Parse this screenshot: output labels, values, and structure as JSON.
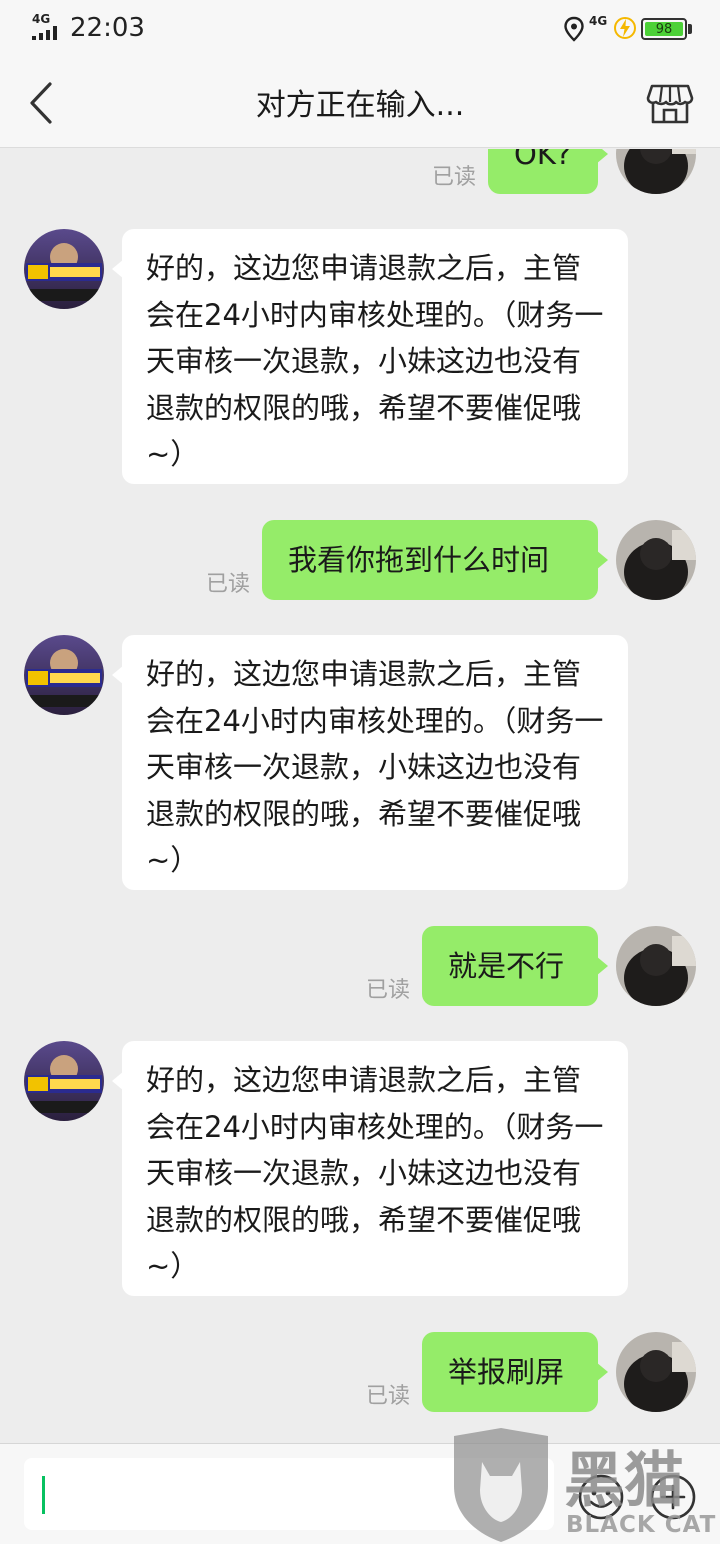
{
  "status_bar": {
    "network_left": "4G",
    "time": "22:03",
    "network_right": "4G",
    "battery": "98",
    "icons": [
      "signal-icon",
      "location-icon",
      "charging-icon",
      "battery-icon"
    ]
  },
  "header": {
    "title": "对方正在输入...",
    "back_icon": "chevron-left-icon",
    "shop_icon": "store-icon"
  },
  "messages": [
    {
      "side": "out",
      "text": "OK?",
      "status": "已读"
    },
    {
      "side": "in",
      "text": "好的，这边您申请退款之后，主管会在24小时内审核处理的。（财务一天审核一次退款，小妹这边也没有退款的权限的哦，希望不要催促哦~）"
    },
    {
      "side": "out",
      "text": "我看你拖到什么时间",
      "status": "已读"
    },
    {
      "side": "in",
      "text": "好的，这边您申请退款之后，主管会在24小时内审核处理的。（财务一天审核一次退款，小妹这边也没有退款的权限的哦，希望不要催促哦~）"
    },
    {
      "side": "out",
      "text": "就是不行",
      "status": "已读"
    },
    {
      "side": "in",
      "text": "好的，这边您申请退款之后，主管会在24小时内审核处理的。（财务一天审核一次退款，小妹这边也没有退款的权限的哦，希望不要催促哦~）"
    },
    {
      "side": "out",
      "text": "举报刷屏",
      "status": "已读"
    }
  ],
  "input_bar": {
    "placeholder": "",
    "icons": [
      "emoji-icon",
      "plus-icon"
    ]
  },
  "watermark": {
    "big": "黑猫",
    "text": "BLACK CAT"
  },
  "colors": {
    "outgoing_bubble": "#95ec69",
    "incoming_bubble": "#ffffff",
    "background": "#ededed",
    "battery": "#4cd137"
  }
}
